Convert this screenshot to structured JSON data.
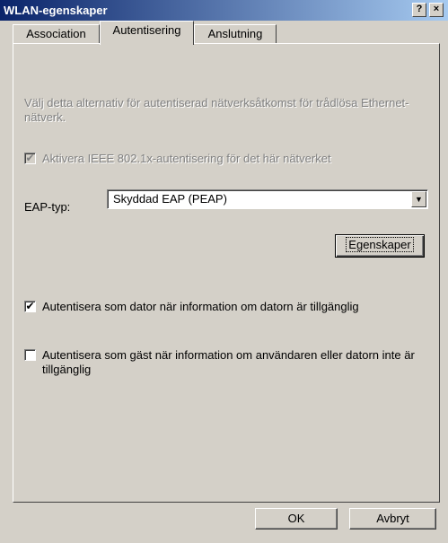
{
  "window": {
    "title": "WLAN-egenskaper",
    "help_button": "?",
    "close_button": "×"
  },
  "tabs": [
    {
      "label": "Association"
    },
    {
      "label": "Autentisering",
      "active": true
    },
    {
      "label": "Anslutning"
    }
  ],
  "panel": {
    "description": "Välj detta alternativ för autentiserad nätverksåtkomst för trådlösa Ethernet-nätverk.",
    "ieee_checkbox": {
      "label": "Aktivera IEEE 802.1x-autentisering för det här nätverket",
      "checked": true,
      "disabled": true
    },
    "eap": {
      "label": "EAP-typ:",
      "selected": "Skyddad EAP (PEAP)"
    },
    "properties_button": "Egenskaper",
    "auth_computer": {
      "label": "Autentisera som dator när information om datorn är tillgänglig",
      "checked": true
    },
    "auth_guest": {
      "label": "Autentisera som gäst när information om användaren eller datorn inte är tillgänglig",
      "checked": false
    }
  },
  "footer": {
    "ok_label": "OK",
    "cancel_label": "Avbryt"
  },
  "icons": {
    "check": "check-mark-icon",
    "dropdown": "chevron-down-icon"
  }
}
